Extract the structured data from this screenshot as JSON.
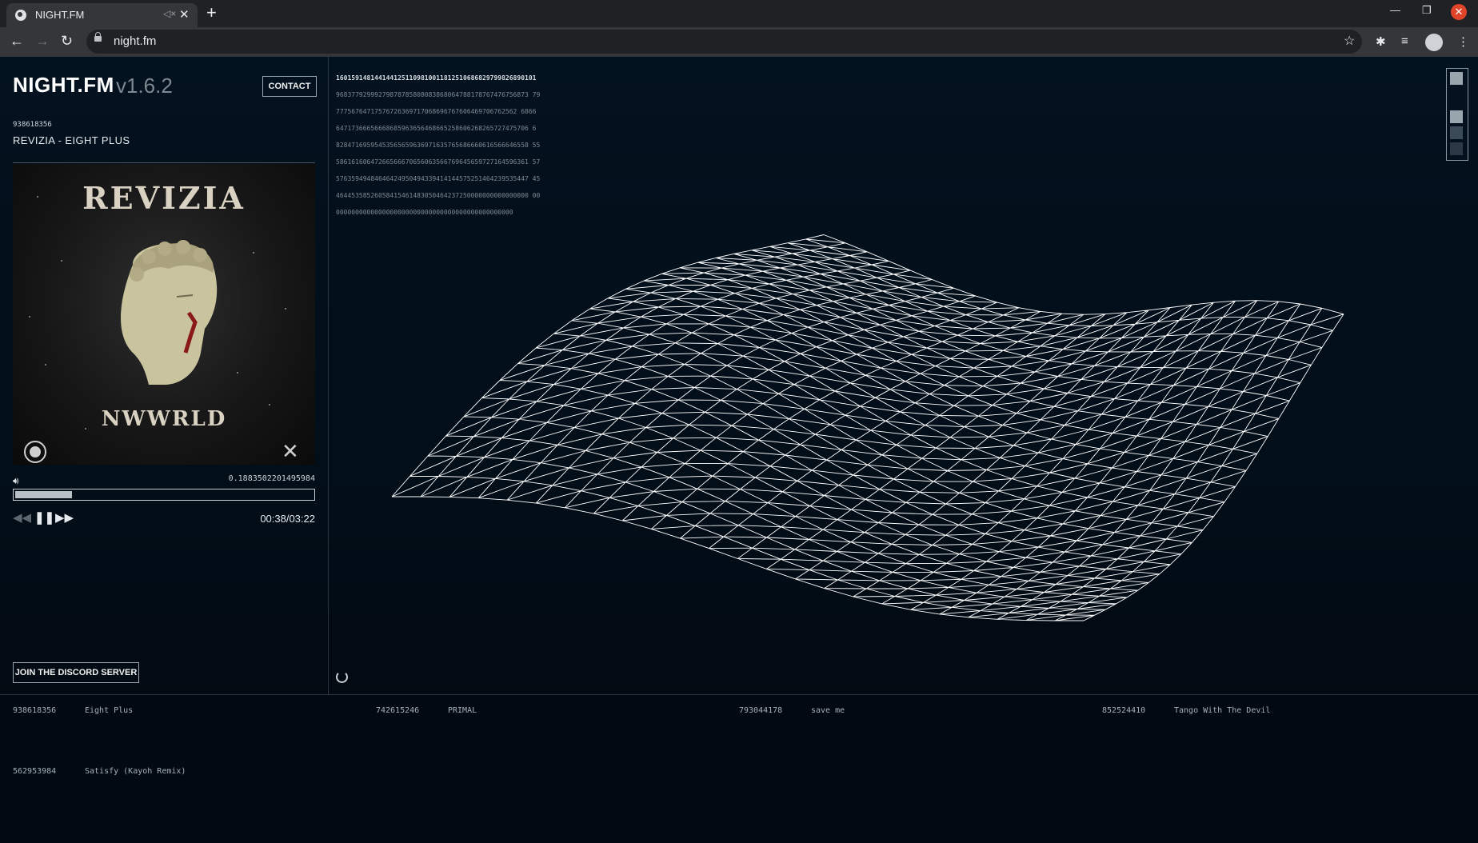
{
  "browser": {
    "tab_title": "NIGHT.FM",
    "url": "night.fm"
  },
  "header": {
    "brand": "NIGHT.FM",
    "version": "v1.6.2",
    "contact_label": "CONTACT"
  },
  "now_playing": {
    "track_id": "938618356",
    "title": "REVIZIA - EIGHT PLUS",
    "cover_artist": "REVIZIA",
    "cover_label": "NWWRLD",
    "volume_value": "0.1883502201495984",
    "progress": 0.19,
    "time": "00:38/03:22"
  },
  "discord_label": "JOIN THE DISCORD SERVER",
  "number_stream": [
    "1601591481441441251109810011812510686829799826890101",
    "96837792999279878785808083868064788178767476756873 79",
    "77756764717576726369717068696767606469706762562 6866",
    "64717366656668685963656468665258606268265727475706 6",
    "82847169595453565659636971635765686660616566646558 55",
    "58616160647266566670656063566769645659727164596361 57",
    "57635949484646424950494339414144575251464239535447 45",
    "46445358526058415461483050464237250000000000000000 00",
    "0000000000000000000000000000000000000000000000"
  ],
  "queue": [
    {
      "id": "938618356",
      "title": "Eight Plus"
    },
    {
      "id": "742615246",
      "title": "PRIMAL"
    },
    {
      "id": "793044178",
      "title": "save me"
    },
    {
      "id": "852524410",
      "title": "Tango With The Devil"
    },
    {
      "id": "562953984",
      "title": "Satisfy (Kayoh Remix)"
    }
  ],
  "icons": {
    "volume": "speaker-icon",
    "prev": "rewind-icon",
    "pause": "pause-icon",
    "next": "fast-forward-icon"
  },
  "colors": {
    "background": "#03121f",
    "accent": "#ffffff"
  }
}
